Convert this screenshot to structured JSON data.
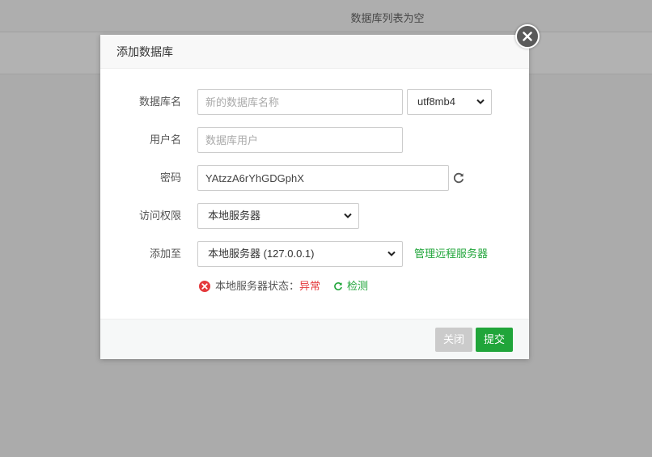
{
  "background": {
    "empty_text": "数据库列表为空"
  },
  "modal": {
    "title": "添加数据库",
    "fields": {
      "db_name": {
        "label": "数据库名",
        "value": "",
        "placeholder": "新的数据库名称"
      },
      "charset": {
        "selected": "utf8mb4"
      },
      "username": {
        "label": "用户名",
        "value": "",
        "placeholder": "数据库用户"
      },
      "password": {
        "label": "密码",
        "value": "YAtzzA6rYhGDGphX"
      },
      "access": {
        "label": "访问权限",
        "selected": "本地服务器"
      },
      "add_to": {
        "label": "添加至",
        "selected": "本地服务器 (127.0.0.1)"
      }
    },
    "manage_remote_link": "管理远程服务器",
    "status": {
      "label": "本地服务器状态：",
      "value": "异常",
      "check_label": "检测"
    },
    "buttons": {
      "cancel": "关闭",
      "submit": "提交"
    }
  },
  "colors": {
    "accent_green": "#20a53a",
    "error_red": "#e4393c",
    "cancel_gray": "#cbcbcb"
  },
  "icons": {
    "close": "close-icon",
    "refresh": "refresh-icon",
    "error": "error-circle-icon",
    "check": "check-refresh-icon",
    "dropdown": "chevron-down-icon"
  }
}
